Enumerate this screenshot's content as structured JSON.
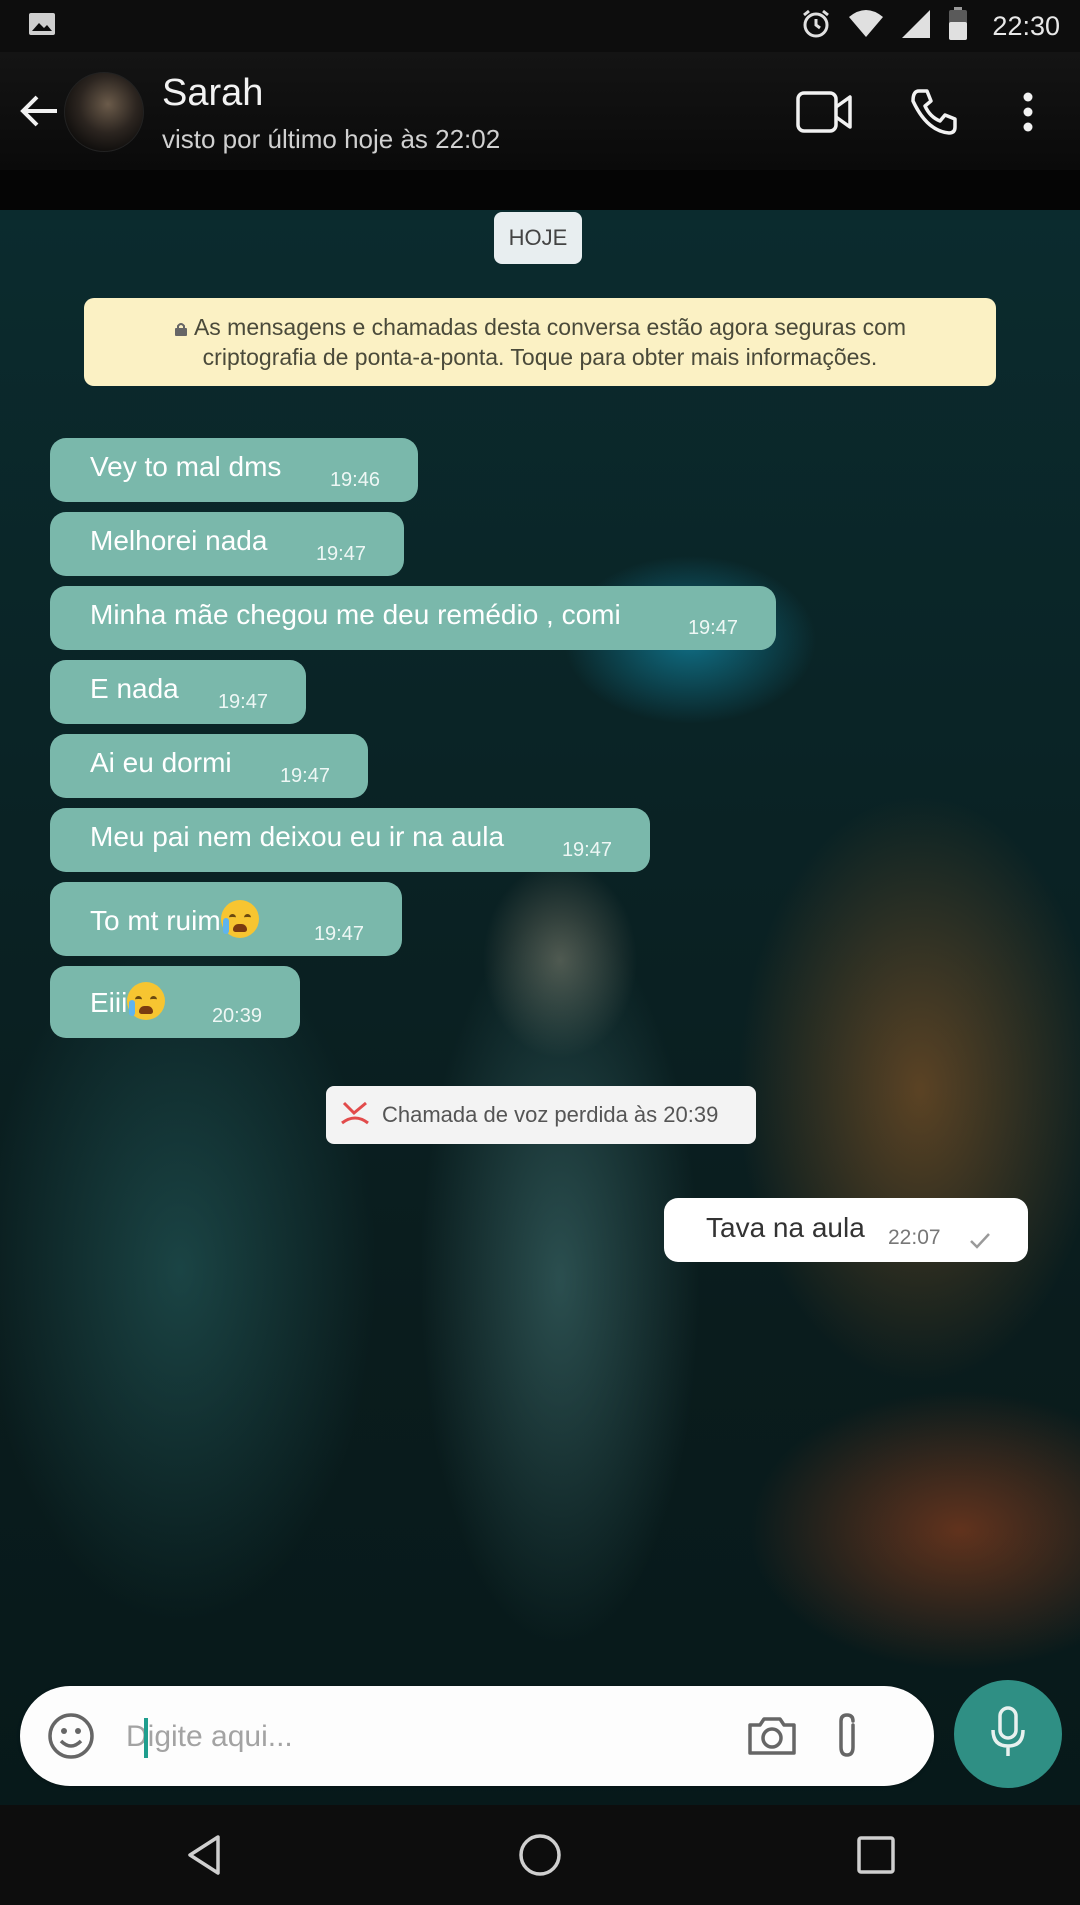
{
  "status_bar": {
    "time": "22:30",
    "icons": [
      "image-icon",
      "alarm-icon",
      "wifi-icon",
      "cell-signal-icon",
      "battery-icon"
    ]
  },
  "header": {
    "contact_name": "Sarah",
    "last_seen": "visto por último hoje às 22:02",
    "icons": [
      "back-arrow-icon",
      "video-call-icon",
      "voice-call-icon",
      "more-options-icon"
    ]
  },
  "chat": {
    "date_chip": "HOJE",
    "encryption_notice_line1": "As mensagens e chamadas desta conversa estão agora seguras com",
    "encryption_notice_line2": "criptografia de ponta-a-ponta. Toque para obter mais informações.",
    "incoming": [
      {
        "text": "Vey to mal dms",
        "time": "19:46"
      },
      {
        "text": "Melhorei nada",
        "time": "19:47"
      },
      {
        "text": "Minha mãe chegou me deu remédio , comi",
        "time": "19:47"
      },
      {
        "text": "E nada",
        "time": "19:47"
      },
      {
        "text": "Ai eu dormi",
        "time": "19:47"
      },
      {
        "text": "Meu pai nem deixou eu ir na aula",
        "time": "19:47"
      },
      {
        "text": "To mt ruim",
        "time": "19:47",
        "emoji": "loudly-crying-face"
      },
      {
        "text": "Eiii",
        "time": "20:39",
        "emoji": "crying-face"
      }
    ],
    "missed_call": "Chamada de voz perdida às 20:39",
    "outgoing": {
      "text": "Tava na aula",
      "time": "22:07",
      "status": "sent-check"
    }
  },
  "input": {
    "placeholder": "Digite aqui..."
  },
  "colors": {
    "incoming_bubble": "#7ab8ab",
    "outgoing_bubble": "#ffffff",
    "notice_bg": "#fbf1c4",
    "accent": "#2f8f84"
  }
}
